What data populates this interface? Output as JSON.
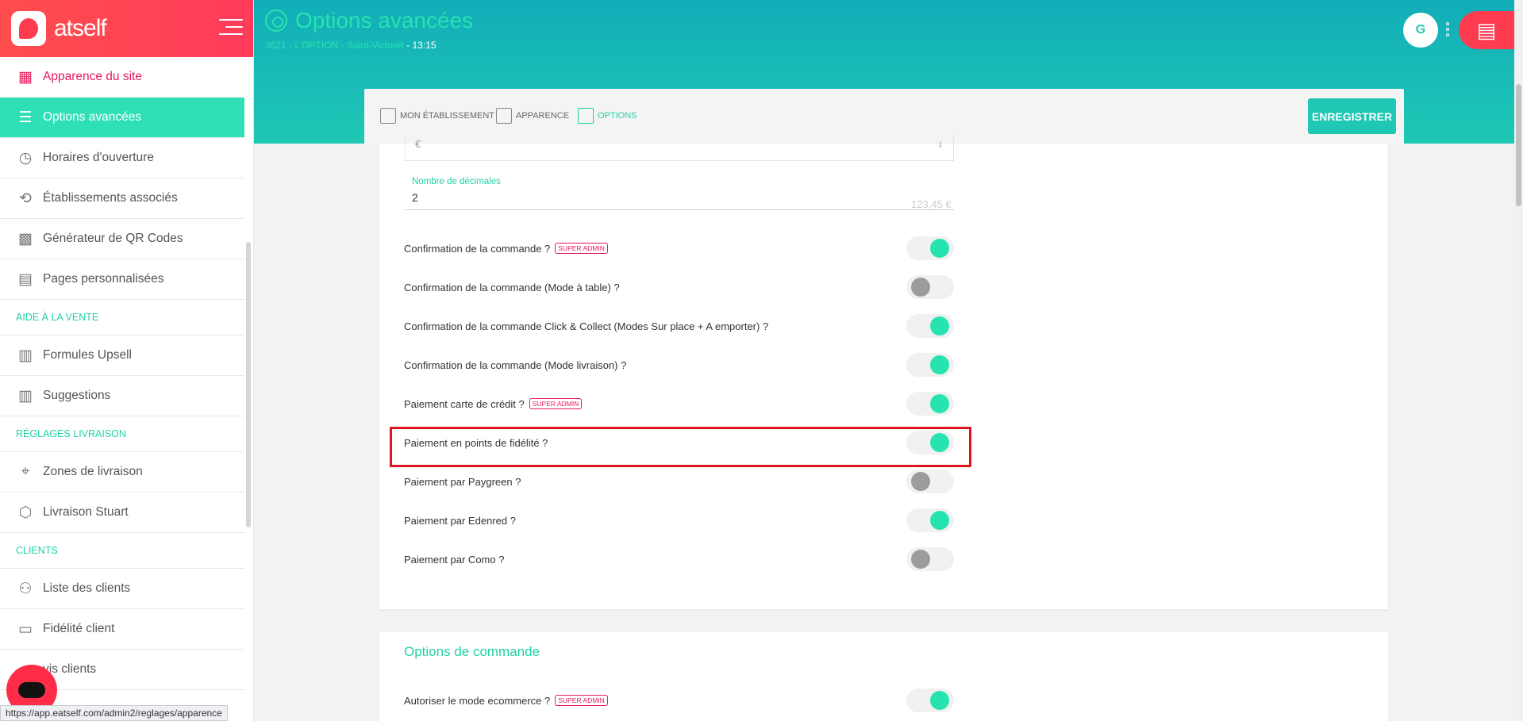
{
  "brand": {
    "name": "atself"
  },
  "sidebar": {
    "items": [
      {
        "label": "Apparence du site",
        "icon": "palette-icon",
        "glyph": "▦",
        "state": "pink"
      },
      {
        "label": "Options avancées",
        "icon": "sliders-icon",
        "glyph": "☰",
        "state": "active"
      },
      {
        "label": "Horaires d'ouverture",
        "icon": "clock-icon",
        "glyph": "◷",
        "state": ""
      },
      {
        "label": "Établissements associés",
        "icon": "network-icon",
        "glyph": "⟲",
        "state": ""
      },
      {
        "label": "Générateur de QR Codes",
        "icon": "qr-code-icon",
        "glyph": "▩",
        "state": ""
      },
      {
        "label": "Pages personnalisées",
        "icon": "layout-icon",
        "glyph": "▤",
        "state": ""
      },
      {
        "section": "AIDE À LA VENTE"
      },
      {
        "label": "Formules Upsell",
        "icon": "store-icon",
        "glyph": "▥",
        "state": ""
      },
      {
        "label": "Suggestions",
        "icon": "store-icon",
        "glyph": "▥",
        "state": ""
      },
      {
        "section": "RÉGLAGES LIVRAISON"
      },
      {
        "label": "Zones de livraison",
        "icon": "map-pin-icon",
        "glyph": "⌖",
        "state": ""
      },
      {
        "label": "Livraison Stuart",
        "icon": "box-icon",
        "glyph": "⬡",
        "state": ""
      },
      {
        "section": "CLIENTS"
      },
      {
        "label": "Liste des clients",
        "icon": "users-icon",
        "glyph": "⚇",
        "state": ""
      },
      {
        "label": "Fidélité client",
        "icon": "card-icon",
        "glyph": "▭",
        "state": ""
      },
      {
        "label": "vis clients",
        "icon": "star-icon",
        "glyph": "",
        "state": ""
      }
    ]
  },
  "status_url": "https://app.eatself.com/admin2/reglages/apparence",
  "header": {
    "title": "Options avancées",
    "subtitle": "3621 - L'OPTION - Saint-Victoret",
    "time": "- 13:15",
    "avatar_initial": "G"
  },
  "tabs": [
    {
      "label": "MON ÉTABLISSEMENT",
      "active": false
    },
    {
      "label": "APPARENCE",
      "active": false
    },
    {
      "label": "OPTIONS",
      "active": true
    }
  ],
  "save_label": "ENREGISTRER",
  "currency_field": {
    "value": "€",
    "arrows": "⇕"
  },
  "decimals": {
    "label": "Nombre de décimales",
    "value": "2",
    "hint": "123,45 €"
  },
  "options": [
    {
      "label": "Confirmation de la commande ?",
      "badge": "SUPER ADMIN",
      "on": true
    },
    {
      "label": "Confirmation de la commande (Mode à table) ?",
      "badge": "",
      "on": false
    },
    {
      "label": "Confirmation de la commande Click & Collect (Modes Sur place + A emporter) ?",
      "badge": "",
      "on": true
    },
    {
      "label": "Confirmation de la commande (Mode livraison) ?",
      "badge": "",
      "on": true
    },
    {
      "label": "Paiement carte de crédit ?",
      "badge": "SUPER ADMIN",
      "on": true
    },
    {
      "label": "Paiement en points de fidélité ?",
      "badge": "",
      "on": true
    },
    {
      "label": "Paiement par Paygreen ?",
      "badge": "",
      "on": false
    },
    {
      "label": "Paiement par Edenred ?",
      "badge": "",
      "on": true
    },
    {
      "label": "Paiement par Como ?",
      "badge": "",
      "on": false
    }
  ],
  "order_options": {
    "title": "Options de commande",
    "items": [
      {
        "label": "Autoriser le mode ecommerce ?",
        "badge": "SUPER ADMIN",
        "on": true
      }
    ]
  },
  "colors": {
    "accent": "#27e3b0",
    "brand": "#ff3b50",
    "badge": "#e8195b",
    "highlight": "#e0141e"
  }
}
